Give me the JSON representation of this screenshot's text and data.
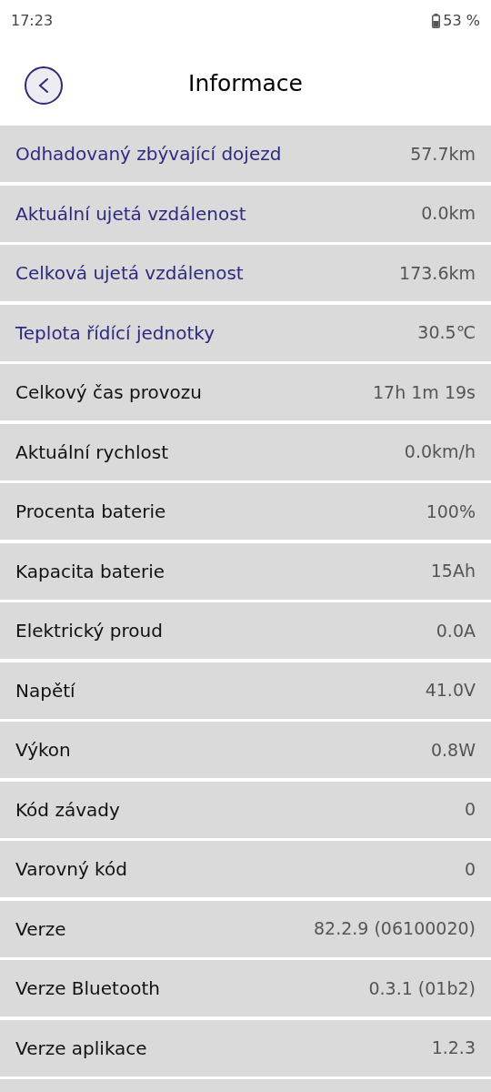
{
  "status_bar": {
    "time": "17:23",
    "battery": "53 %"
  },
  "header": {
    "title": "Informace"
  },
  "rows": [
    {
      "kind": "accent",
      "label": "Odhadovaný zbývající dojezd",
      "value": "57.7km"
    },
    {
      "kind": "accent",
      "label": "Aktuální ujetá vzdálenost",
      "value": "0.0km"
    },
    {
      "kind": "accent",
      "label": "Celková ujetá vzdálenost",
      "value": "173.6km"
    },
    {
      "kind": "accent",
      "label": "Teplota řídící jednotky",
      "value": "30.5℃"
    },
    {
      "kind": "plain",
      "label": "Celkový čas provozu",
      "value": "17h 1m 19s"
    },
    {
      "kind": "plain",
      "label": "Aktuální rychlost",
      "value": "0.0km/h"
    },
    {
      "kind": "plain",
      "label": "Procenta baterie",
      "value": "100%"
    },
    {
      "kind": "plain",
      "label": "Kapacita baterie",
      "value": "15Ah"
    },
    {
      "kind": "plain",
      "label": "Elektrický proud",
      "value": "0.0A"
    },
    {
      "kind": "plain",
      "label": "Napětí",
      "value": "41.0V"
    },
    {
      "kind": "plain",
      "label": "Výkon",
      "value": "0.8W"
    },
    {
      "kind": "plain",
      "label": "Kód závady",
      "value": "0"
    },
    {
      "kind": "plain",
      "label": "Varovný kód",
      "value": "0"
    },
    {
      "kind": "plain",
      "label": "Verze",
      "value": "82.2.9 (06100020)"
    },
    {
      "kind": "plain",
      "label": "Verze Bluetooth",
      "value": "0.3.1 (01b2)"
    },
    {
      "kind": "plain",
      "label": "Verze aplikace",
      "value": "1.2.3"
    }
  ]
}
